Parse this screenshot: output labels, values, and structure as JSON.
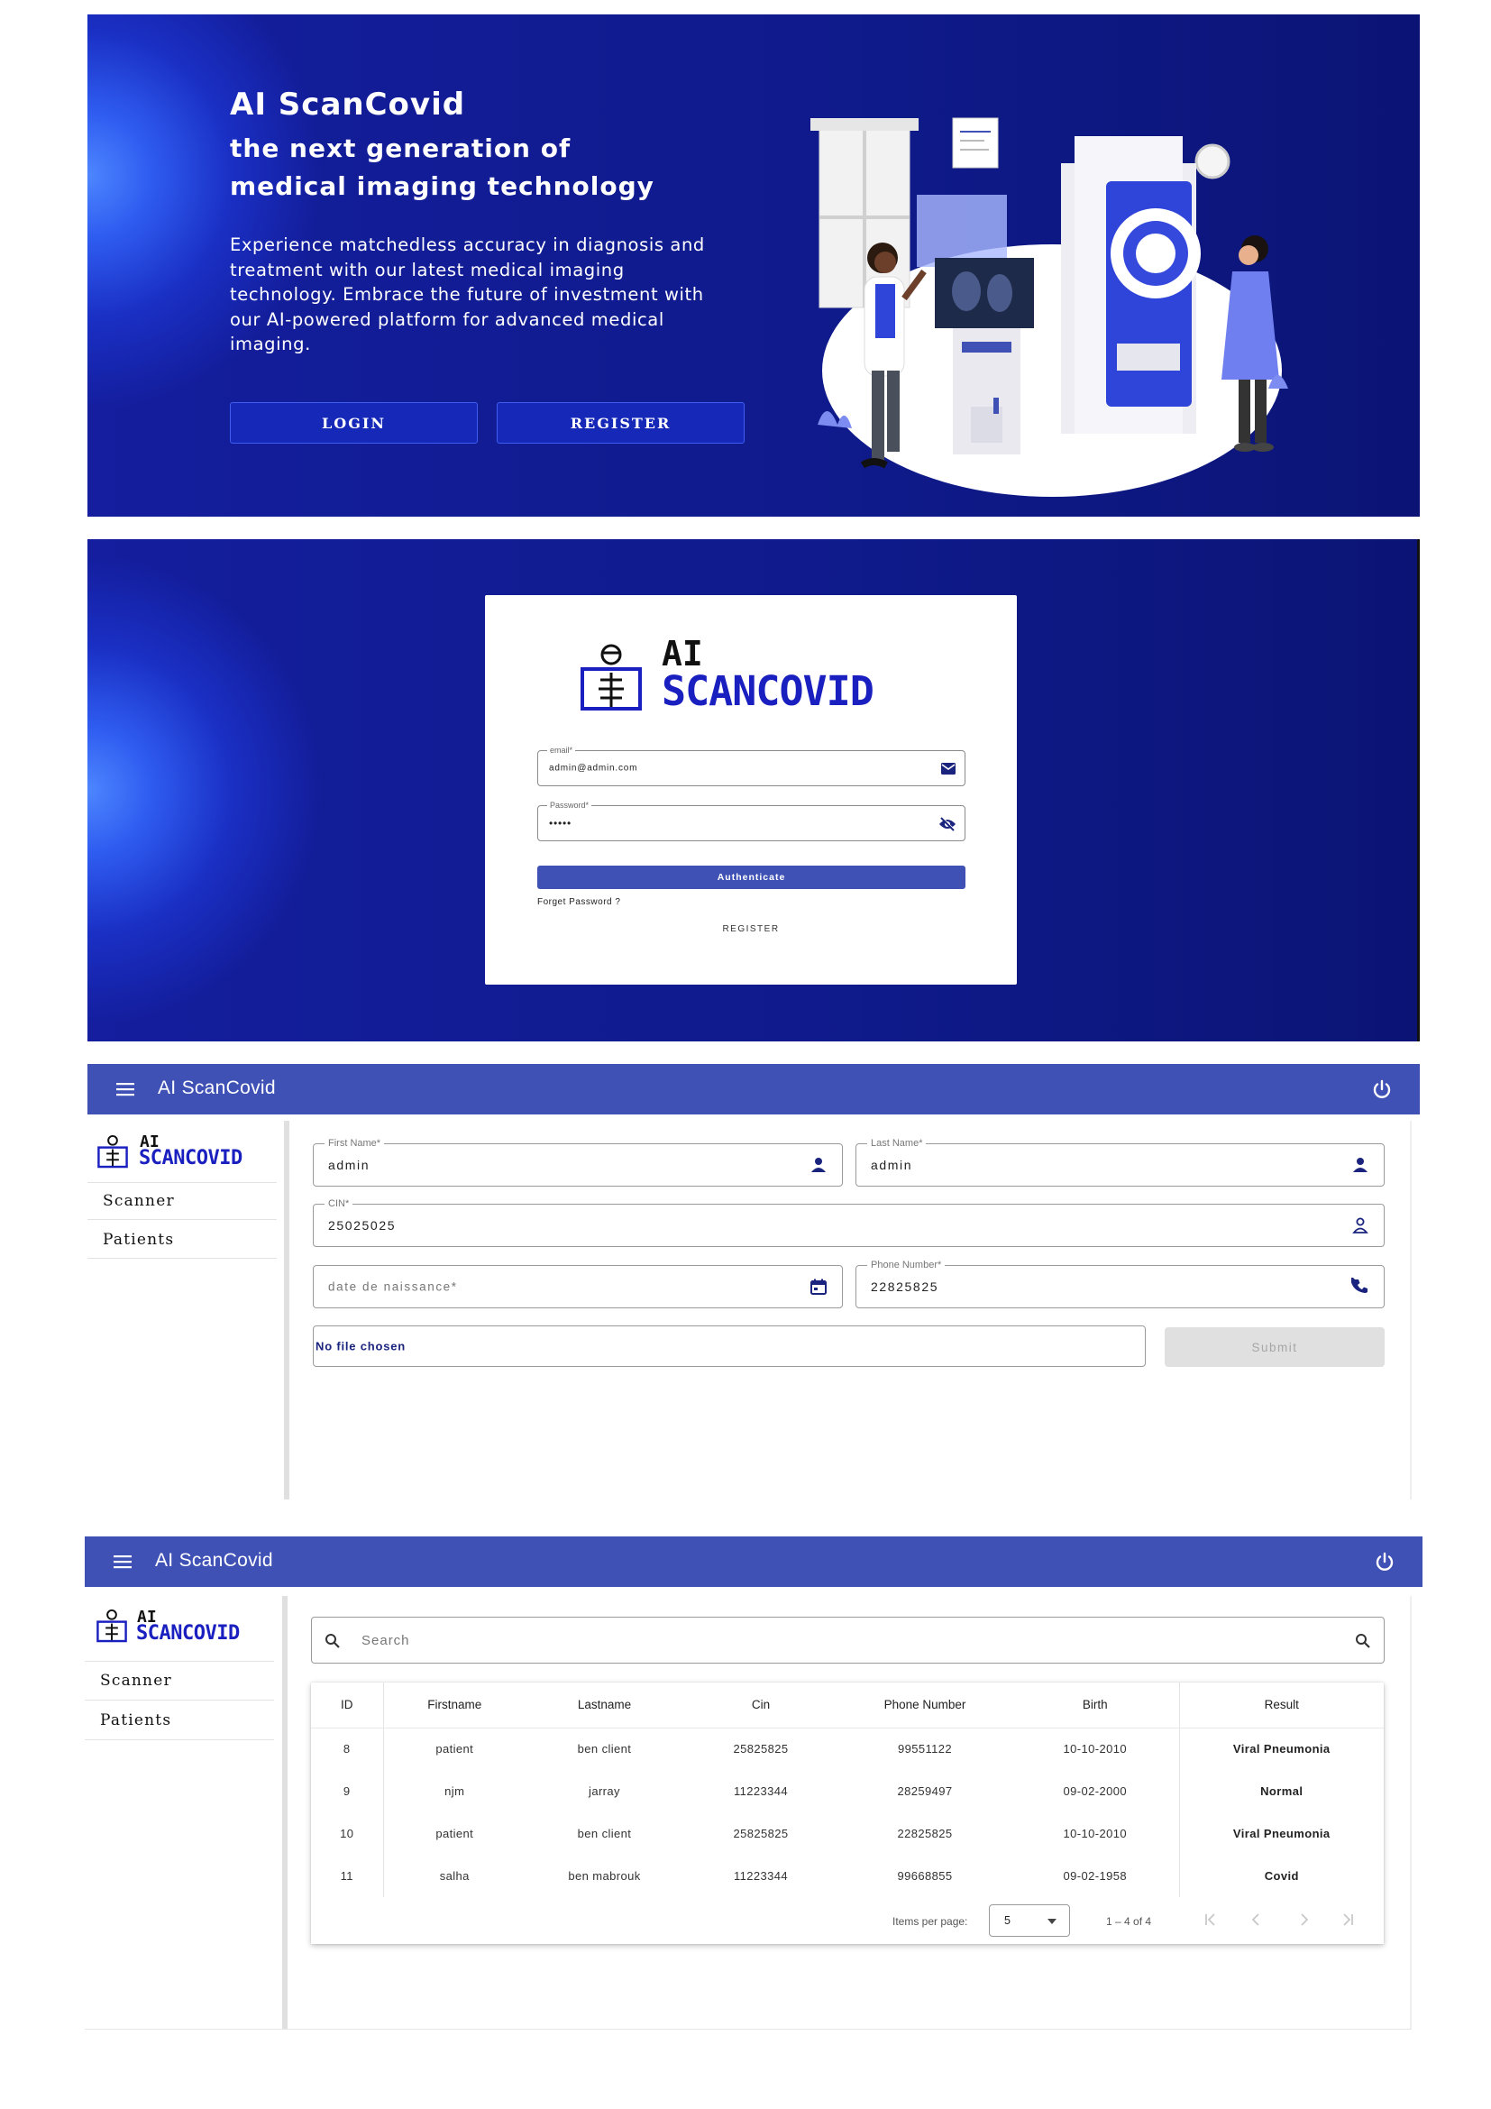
{
  "hero": {
    "title": "AI ScanCovid",
    "subtitle_line1": "the next generation of",
    "subtitle_line2": "medical imaging technology",
    "description": "Experience matchedless accuracy in diagnosis and treatment with our latest medical imaging technology. Embrace the future of investment with our AI-powered platform for advanced medical imaging.",
    "login_label": "LOGIN",
    "register_label": "REGISTER"
  },
  "login": {
    "brand_ai": "AI",
    "brand_scan": "SCANCOVID",
    "email_label": "email*",
    "email_value": "admin@admin.com",
    "password_label": "Password*",
    "password_value": "•••••",
    "authenticate_label": "Authenticate",
    "forget_label": "Forget Password ?",
    "register_label": "REGISTER"
  },
  "app": {
    "title": "AI ScanCovid",
    "brand_ai": "AI",
    "brand_scan": "SCANCOVID",
    "nav": [
      "Scanner",
      "Patients"
    ]
  },
  "scanner_form": {
    "first_name_label": "First Name*",
    "first_name_value": "admin",
    "last_name_label": "Last Name*",
    "last_name_value": "admin",
    "cin_label": "CIN*",
    "cin_value": "25025025",
    "birth_placeholder": "date de naissance*",
    "phone_label": "Phone Number*",
    "phone_value": "22825825",
    "file_text": "No file chosen",
    "submit_label": "Submit"
  },
  "patients": {
    "search_placeholder": "Search",
    "columns": [
      "ID",
      "Firstname",
      "Lastname",
      "Cin",
      "Phone Number",
      "Birth",
      "Result"
    ],
    "rows": [
      [
        "8",
        "patient",
        "ben client",
        "25825825",
        "99551122",
        "10-10-2010",
        "Viral Pneumonia"
      ],
      [
        "9",
        "njm",
        "jarray",
        "11223344",
        "28259497",
        "09-02-2000",
        "Normal"
      ],
      [
        "10",
        "patient",
        "ben client",
        "25825825",
        "22825825",
        "10-10-2010",
        "Viral Pneumonia"
      ],
      [
        "11",
        "salha",
        "ben mabrouk",
        "11223344",
        "99668855",
        "09-02-1958",
        "Covid"
      ]
    ],
    "items_per_page_label": "Items per page:",
    "items_per_page_value": "5",
    "range_label": "1 – 4 of 4"
  },
  "colors": {
    "primary": "#3f51b5",
    "hero_bg": "#0f1a8a",
    "brand_blue": "#1a1fbf"
  }
}
